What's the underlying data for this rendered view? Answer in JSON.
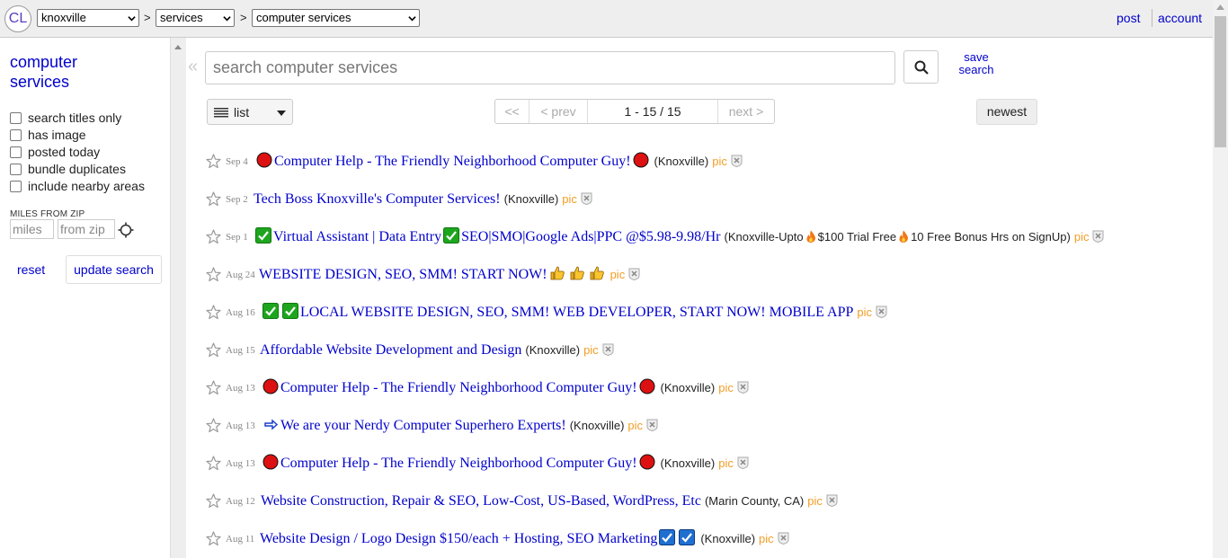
{
  "header": {
    "logo": "CL",
    "city": "knoxville",
    "category_group": "services",
    "category": "computer services",
    "separator": ">",
    "post": "post",
    "account": "account"
  },
  "sidebar": {
    "title_line1": "computer",
    "title_line2": "services",
    "filters": [
      {
        "label": "search titles only",
        "checked": false
      },
      {
        "label": "has image",
        "checked": false
      },
      {
        "label": "posted today",
        "checked": false
      },
      {
        "label": "bundle duplicates",
        "checked": false
      },
      {
        "label": "include nearby areas",
        "checked": false
      }
    ],
    "miles_label": "MILES FROM ZIP",
    "miles_placeholder": "miles",
    "zip_placeholder": "from zip",
    "reset": "reset",
    "update": "update search"
  },
  "search": {
    "collapse": "«",
    "placeholder": "search computer services",
    "save_line1": "save",
    "save_line2": "search"
  },
  "toolbar": {
    "view": "list",
    "first": "<<",
    "prev": "< prev",
    "range": "1 - 15 / 15",
    "next": "next >",
    "sort": "newest"
  },
  "listings": [
    {
      "date": "Sep 4",
      "title": "Computer Help - The Friendly Neighborhood Computer Guy!",
      "location": "(Knoxville)",
      "pic": "pic",
      "pre": [
        "red-circle"
      ],
      "post": [
        "red-circle"
      ]
    },
    {
      "date": "Sep 2",
      "title": "Tech Boss Knoxville's Computer Services!",
      "location": "(Knoxville)",
      "pic": "pic",
      "pre": [],
      "post": []
    },
    {
      "date": "Sep 1",
      "title_a": "Virtual Assistant | Data Entry",
      "title_b": "SEO|SMO|Google Ads|PPC @$5.98-9.98/Hr",
      "location_a": "(Knoxville-Upto",
      "location_b": "$100 Trial Free",
      "location_c": "10 Free Bonus Hrs on SignUp)",
      "pic": "pic"
    },
    {
      "date": "Aug 24",
      "title": "WEBSITE DESIGN, SEO, SMM! START NOW!",
      "location": "",
      "pic": "pic",
      "pre": [],
      "post": [
        "thumbs-up",
        "thumbs-up",
        "thumbs-up"
      ]
    },
    {
      "date": "Aug 16",
      "title": "LOCAL WEBSITE DESIGN, SEO, SMM! WEB DEVELOPER, START NOW! MOBILE APP",
      "location": "",
      "pic": "pic",
      "pre": [
        "green-check",
        "green-check"
      ],
      "post": []
    },
    {
      "date": "Aug 15",
      "title": "Affordable Website Development and Design",
      "location": "(Knoxville)",
      "pic": "pic",
      "pre": [],
      "post": []
    },
    {
      "date": "Aug 13",
      "title": "Computer Help - The Friendly Neighborhood Computer Guy!",
      "location": "(Knoxville)",
      "pic": "pic",
      "pre": [
        "red-circle"
      ],
      "post": [
        "red-circle"
      ]
    },
    {
      "date": "Aug 13",
      "title": "We are your Nerdy Computer Superhero Experts!",
      "location": "(Knoxville)",
      "pic": "pic",
      "pre": [
        "arrow"
      ],
      "post": []
    },
    {
      "date": "Aug 13",
      "title": "Computer Help - The Friendly Neighborhood Computer Guy!",
      "location": "(Knoxville)",
      "pic": "pic",
      "pre": [
        "red-circle"
      ],
      "post": [
        "red-circle"
      ]
    },
    {
      "date": "Aug 12",
      "title": "Website Construction, Repair & SEO, Low-Cost, US-Based, WordPress, Etc",
      "location": "(Marin County, CA)",
      "pic": "pic",
      "pre": [],
      "post": []
    },
    {
      "date": "Aug 11",
      "title": "Website Design / Logo Design $150/each + Hosting, SEO Marketing",
      "location": "(Knoxville)",
      "pic": "pic",
      "pre": [],
      "post": [
        "blue-check",
        "blue-check"
      ]
    }
  ],
  "colors": {
    "link": "#0000cc",
    "pic": "#f29e25",
    "bar": "#eeeeee"
  }
}
